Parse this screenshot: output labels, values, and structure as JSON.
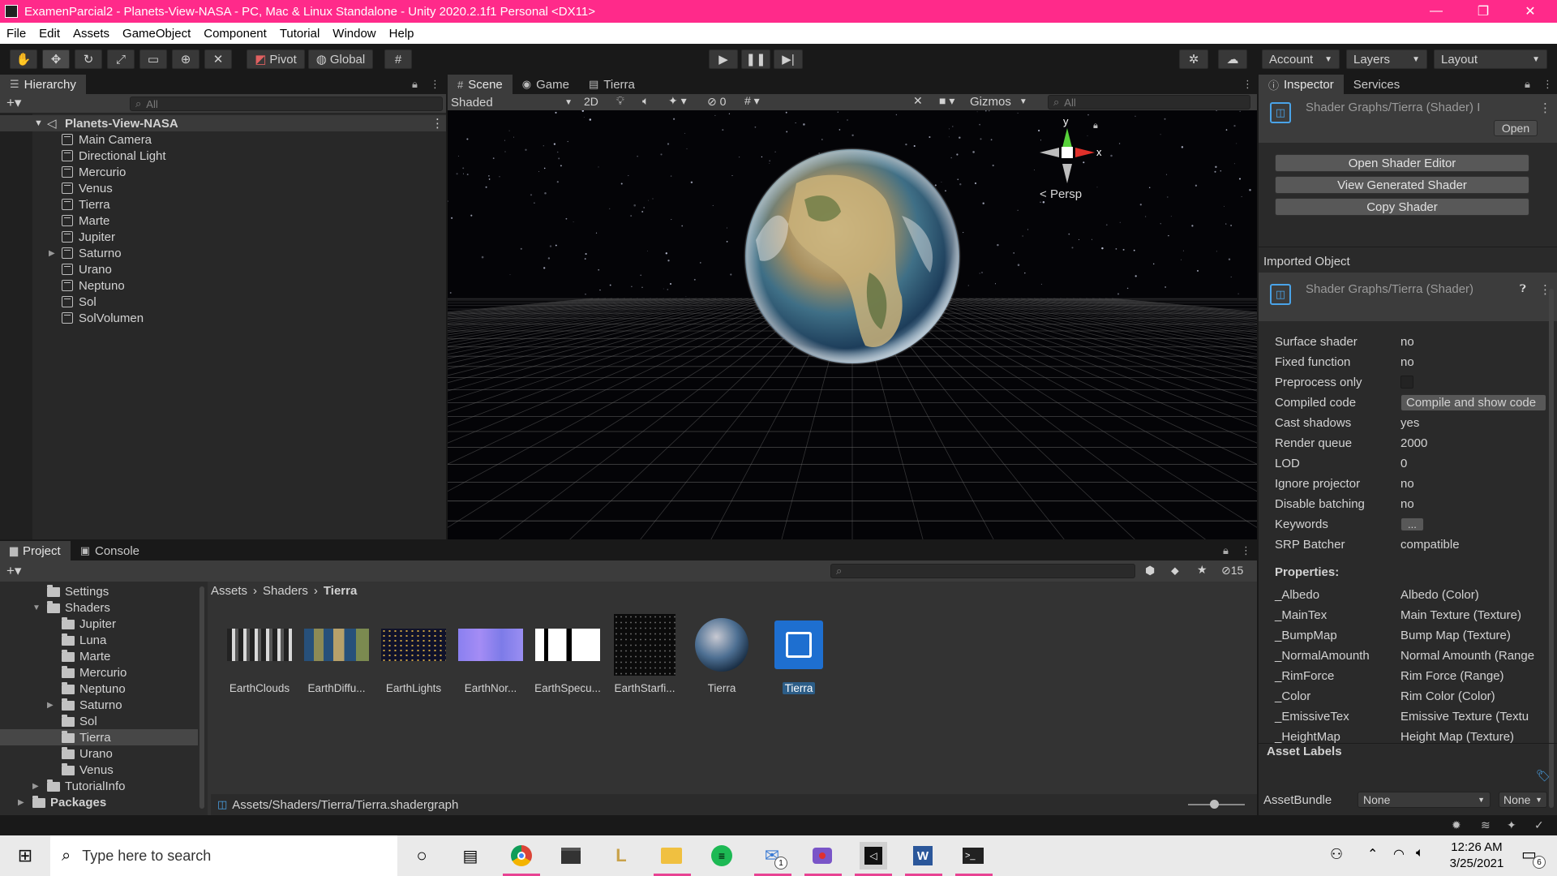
{
  "window": {
    "title": "ExamenParcial2 - Planets-View-NASA - PC, Mac & Linux Standalone - Unity 2020.2.1f1 Personal <DX11>",
    "minimize": "—",
    "maximize": "❐",
    "close": "✕"
  },
  "menu": [
    "File",
    "Edit",
    "Assets",
    "GameObject",
    "Component",
    "Tutorial",
    "Window",
    "Help"
  ],
  "toolbar": {
    "pivot_label": "Pivot",
    "global_label": "Global",
    "account_label": "Account",
    "layers_label": "Layers",
    "layout_label": "Layout"
  },
  "hierarchy": {
    "tab_label": "Hierarchy",
    "search_placeholder": "All",
    "scene_name": "Planets-View-NASA",
    "items": [
      {
        "label": "Main Camera",
        "expandable": false
      },
      {
        "label": "Directional Light",
        "expandable": false
      },
      {
        "label": "Mercurio",
        "expandable": false
      },
      {
        "label": "Venus",
        "expandable": false
      },
      {
        "label": "Tierra",
        "expandable": false
      },
      {
        "label": "Marte",
        "expandable": false
      },
      {
        "label": "Jupiter",
        "expandable": false
      },
      {
        "label": "Saturno",
        "expandable": true
      },
      {
        "label": "Urano",
        "expandable": false
      },
      {
        "label": "Neptuno",
        "expandable": false
      },
      {
        "label": "Sol",
        "expandable": false
      },
      {
        "label": "SolVolumen",
        "expandable": false
      }
    ]
  },
  "scene": {
    "tabs": [
      "Scene",
      "Game",
      "Tierra"
    ],
    "shading_mode": "Shaded",
    "mode_2d": "2D",
    "hidden_count": "0",
    "gizmos_label": "Gizmos",
    "search_placeholder": "All",
    "gizmo_y": "y",
    "gizmo_x": "x",
    "projection_label": "Persp"
  },
  "inspector": {
    "tabs": [
      "Inspector",
      "Services"
    ],
    "header_title": "Shader Graphs/Tierra (Shader) I",
    "open_label": "Open",
    "buttons": [
      "Open Shader Editor",
      "View Generated Shader",
      "Copy Shader"
    ],
    "imported_object_label": "Imported Object",
    "imported_title": "Shader Graphs/Tierra (Shader)",
    "properties": [
      {
        "key": "Surface shader",
        "value": "no"
      },
      {
        "key": "Fixed function",
        "value": "no"
      },
      {
        "key": "Preprocess only",
        "value": ""
      },
      {
        "key": "Compiled code",
        "value": "Compile and show code"
      },
      {
        "key": "Cast shadows",
        "value": "yes"
      },
      {
        "key": "Render queue",
        "value": "2000"
      },
      {
        "key": "LOD",
        "value": "0"
      },
      {
        "key": "Ignore projector",
        "value": "no"
      },
      {
        "key": "Disable batching",
        "value": "no"
      },
      {
        "key": "Keywords",
        "value": "..."
      },
      {
        "key": "SRP Batcher",
        "value": "compatible"
      }
    ],
    "properties_header": "Properties:",
    "shader_props": [
      {
        "key": "_Albedo",
        "value": "Albedo (Color)"
      },
      {
        "key": "_MainTex",
        "value": "Main Texture (Texture)"
      },
      {
        "key": "_BumpMap",
        "value": "Bump Map (Texture)"
      },
      {
        "key": "_NormalAmounth",
        "value": "Normal Amounth (Range"
      },
      {
        "key": "_RimForce",
        "value": "Rim Force (Range)"
      },
      {
        "key": "_Color",
        "value": "Rim Color (Color)"
      },
      {
        "key": "_EmissiveTex",
        "value": "Emissive Texture (Textu"
      },
      {
        "key": "_HeightMap",
        "value": "Height Map (Texture)"
      }
    ],
    "asset_labels": "Asset Labels",
    "asset_bundle_label": "AssetBundle",
    "asset_bundle_value": "None",
    "asset_variant_value": "None"
  },
  "project": {
    "tabs": [
      "Project",
      "Console"
    ],
    "tree": [
      {
        "label": "Settings",
        "depth": 1,
        "expand": ""
      },
      {
        "label": "Shaders",
        "depth": 1,
        "expand": "open"
      },
      {
        "label": "Jupiter",
        "depth": 2,
        "expand": ""
      },
      {
        "label": "Luna",
        "depth": 2,
        "expand": ""
      },
      {
        "label": "Marte",
        "depth": 2,
        "expand": ""
      },
      {
        "label": "Mercurio",
        "depth": 2,
        "expand": ""
      },
      {
        "label": "Neptuno",
        "depth": 2,
        "expand": ""
      },
      {
        "label": "Saturno",
        "depth": 2,
        "expand": "closed"
      },
      {
        "label": "Sol",
        "depth": 2,
        "expand": ""
      },
      {
        "label": "Tierra",
        "depth": 2,
        "expand": "",
        "selected": true
      },
      {
        "label": "Urano",
        "depth": 2,
        "expand": ""
      },
      {
        "label": "Venus",
        "depth": 2,
        "expand": ""
      },
      {
        "label": "TutorialInfo",
        "depth": 1,
        "expand": "closed"
      },
      {
        "label": "Packages",
        "depth": 0,
        "expand": "closed",
        "bold": true
      }
    ],
    "breadcrumb": [
      "Assets",
      "Shaders",
      "Tierra"
    ],
    "hidden_count": "15",
    "assets": [
      {
        "label": "EarthClouds",
        "kind": "clouds"
      },
      {
        "label": "EarthDiffu...",
        "kind": "diffuse"
      },
      {
        "label": "EarthLights",
        "kind": "lights"
      },
      {
        "label": "EarthNor...",
        "kind": "normal"
      },
      {
        "label": "EarthSpecu...",
        "kind": "specular"
      },
      {
        "label": "EarthStarfi...",
        "kind": "starfield"
      },
      {
        "label": "Tierra",
        "kind": "material"
      },
      {
        "label": "Tierra",
        "kind": "shadergraph",
        "selected": true
      }
    ],
    "status_path": "Assets/Shaders/Tierra/Tierra.shadergraph"
  },
  "taskbar": {
    "search_placeholder": "Type here to search",
    "time": "12:26 AM",
    "date": "3/25/2021",
    "mail_badge": "1",
    "notif_badge": "6"
  },
  "colors": {
    "title_bar": "#ff2a8a",
    "selection": "#2c5d87",
    "panel_bg": "#282828"
  }
}
